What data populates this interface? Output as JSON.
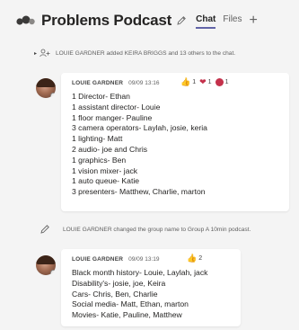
{
  "header": {
    "title": "Problems Podcast",
    "tabs": [
      {
        "label": "Chat",
        "active": true
      },
      {
        "label": "Files",
        "active": false
      }
    ],
    "add_tab": "+"
  },
  "system_messages": [
    {
      "icon": "add-people-icon",
      "text": "LOUIE GARDNER added KEIRA BRIGGS and 13 others to the chat."
    },
    {
      "icon": "pencil-icon",
      "text": "LOUIE GARDNER changed the group name to Group A 10min podcast."
    }
  ],
  "messages": [
    {
      "author": "LOUIE GARDNER",
      "time": "09/09 13:16",
      "reactions": [
        {
          "icon": "thumbs-up-icon",
          "count": "1"
        },
        {
          "icon": "heart-icon",
          "count": "1"
        },
        {
          "icon": "angry-icon",
          "count": "1"
        }
      ],
      "lines": [
        "1 Director- Ethan",
        "1 assistant director- Louie",
        "1 floor manger- Pauline",
        "3 camera operators- Laylah, josie, keria",
        "1 lighting- Matt",
        "2 audio- joe and Chris",
        "1 graphics- Ben",
        "1 vision mixer- jack",
        "1 auto queue- Katie",
        "3 presenters- Matthew, Charlie, marton"
      ]
    },
    {
      "author": "LOUIE GARDNER",
      "time": "09/09 13:19",
      "reactions": [
        {
          "icon": "thumbs-up-icon",
          "count": "2"
        }
      ],
      "lines": [
        "Black month history- Louie, Laylah, jack",
        "Disability's- josie, joe, Keira",
        "Cars- Chris, Ben, Charlie",
        "Social media- Matt, Ethan, marton",
        "Movies- Katie, Pauline, Matthew"
      ]
    }
  ],
  "colors": {
    "accent": "#6264a7",
    "background": "#f4f4f4",
    "card": "#ffffff"
  }
}
